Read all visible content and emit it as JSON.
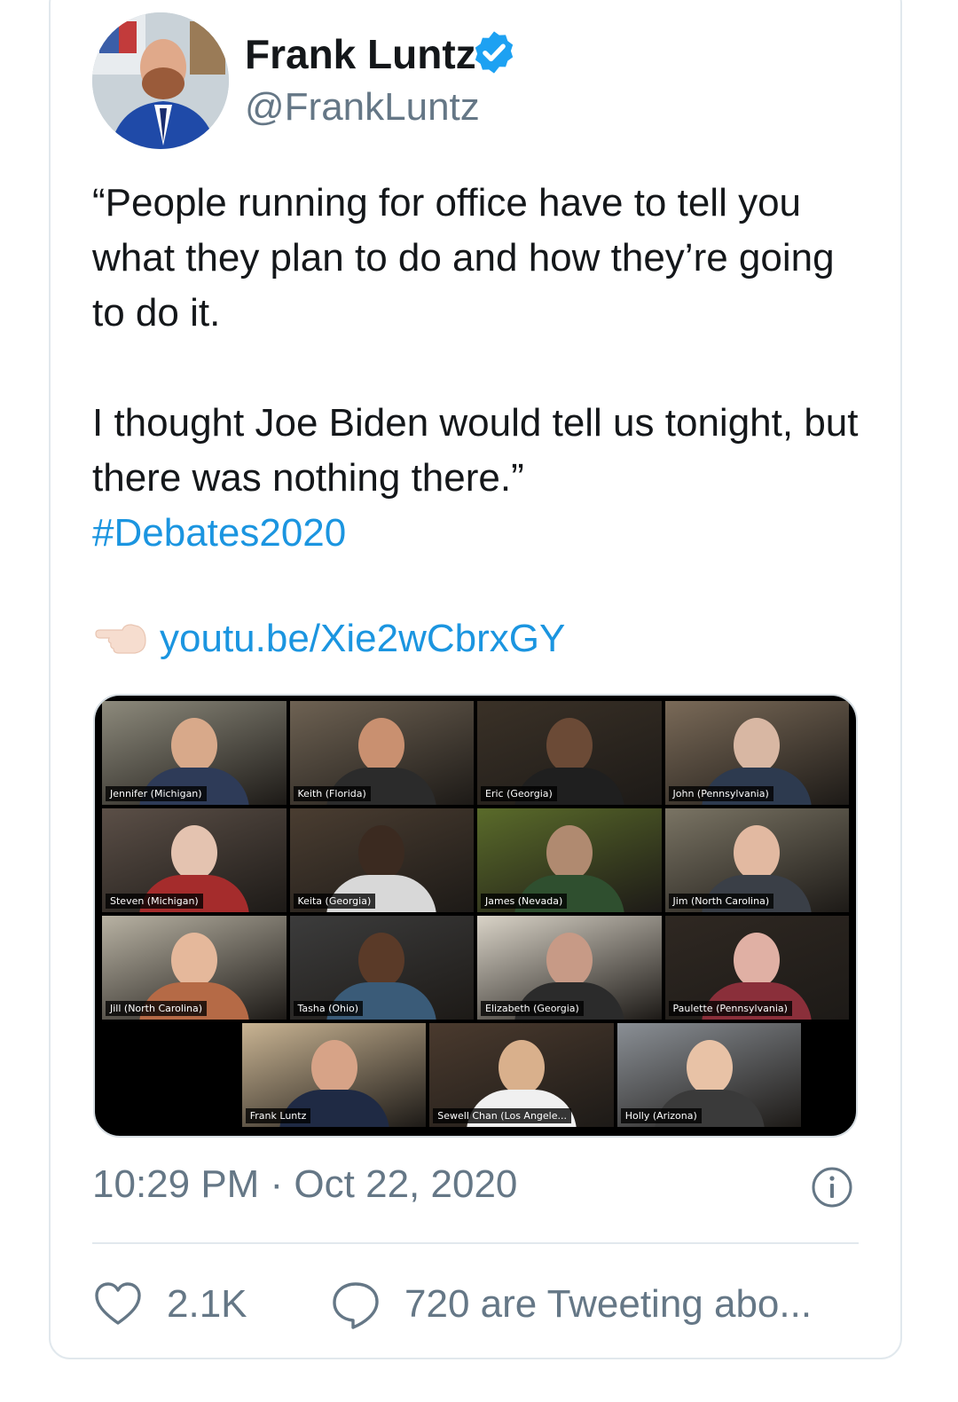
{
  "author": {
    "name": "Frank Luntz",
    "handle": "@FrankLuntz",
    "verified": true
  },
  "tweet": {
    "paragraph1": "“People running for office have to tell you what they plan to do and how they’re going to do it.",
    "paragraph2": "I thought Joe Biden would tell us tonight, but there was nothing there.”",
    "hashtag": "#Debates2020",
    "link_text": "youtu.be/Xie2wCbrxGY",
    "timestamp": "10:29 PM · Oct 22, 2020"
  },
  "media": {
    "participants": [
      "Jennifer (Michigan)",
      "Keith (Florida)",
      "Eric (Georgia)",
      "John (Pennsylvania)",
      "Steven (Michigan)",
      "Keita (Georgia)",
      "James (Nevada)",
      "Jim (North Carolina)",
      "Jill (North Carolina)",
      "Tasha (Ohio)",
      "Elizabeth (Georgia)",
      "Paulette (Pennsylvania)",
      "Frank Luntz",
      "Sewell Chan (Los Angele...",
      "Holly (Arizona)"
    ]
  },
  "stats": {
    "likes": "2.1K",
    "conversation": "720 are Tweeting abo..."
  },
  "colors": {
    "link": "#1b95e0",
    "verified": "#1da1f2",
    "secondary_text": "#657786",
    "border": "#e1e8ed"
  },
  "icons": {
    "verified": "verified-badge-icon",
    "link_hand": "backhand-index-pointing-left-icon",
    "info": "info-icon",
    "like": "heart-icon",
    "reply": "speech-bubble-icon"
  }
}
